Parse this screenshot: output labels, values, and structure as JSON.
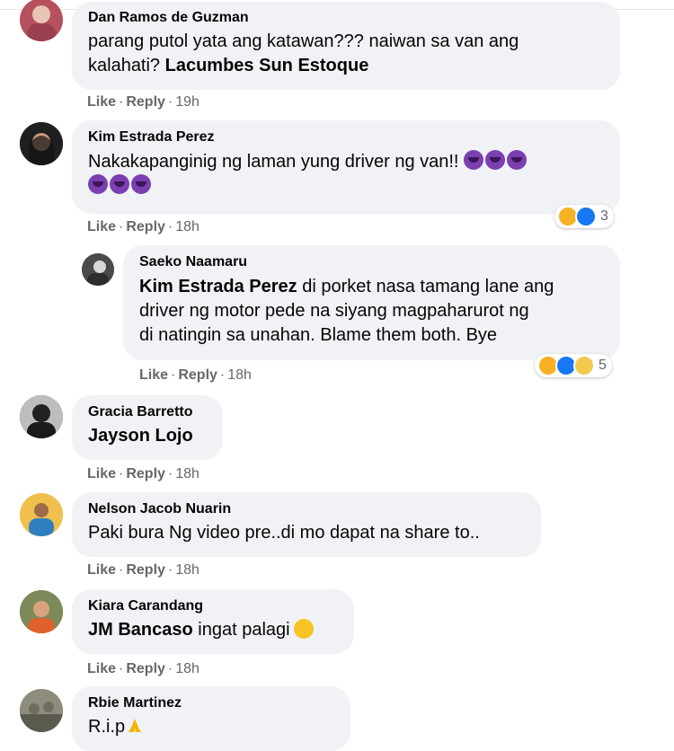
{
  "comments": [
    {
      "name": "Dan Ramos de Guzman",
      "text_line1": "parang putol yata ang katawan??? naiwan sa van ang",
      "text_line2": "kalahati?",
      "tag": "Lacumbes Sun Estoque",
      "like": "Like",
      "reply": "Reply",
      "time": "19h",
      "avatar_color": "#b5505e"
    },
    {
      "name": "Kim Estrada Perez",
      "text_line1": "Nakakapanginig ng laman yung driver ng van!!",
      "like": "Like",
      "reply": "Reply",
      "time": "18h",
      "reaction_count": "3",
      "avatar_color": "#2a2a2a"
    },
    {
      "name": "Saeko Naamaru",
      "tag": "Kim Estrada Perez",
      "text_line1": "di porket nasa tamang lane ang",
      "text_line2": "driver ng motor pede na siyang magpaharurot ng",
      "text_line3": "di natingin sa unahan. Blame them both. Bye",
      "like": "Like",
      "reply": "Reply",
      "time": "18h",
      "reaction_count": "5",
      "avatar_color": "#5a5a5a"
    },
    {
      "name": "Gracia Barretto",
      "tag": "Jayson Lojo",
      "like": "Like",
      "reply": "Reply",
      "time": "18h",
      "avatar_color": "#3b3b3b"
    },
    {
      "name": "Nelson Jacob Nuarin",
      "text_line1": "Paki bura Ng video pre..di mo dapat na share to..",
      "like": "Like",
      "reply": "Reply",
      "time": "18h",
      "avatar_color": "#e8b13c"
    },
    {
      "name": "Kiara Carandang",
      "tag": "JM Bancaso",
      "text_line1": "ingat palagi",
      "like": "Like",
      "reply": "Reply",
      "time": "18h",
      "avatar_color": "#8a7a52"
    },
    {
      "name": "Rbie Martinez",
      "text_line1": "R.i.p",
      "avatar_color": "#6d6b5f"
    }
  ],
  "colors": {
    "bubble": "#f0f2f5",
    "meta": "#65676b",
    "reaction_haha": "#f7b125",
    "reaction_like": "#1877f2",
    "reaction_care": "#f2c94c"
  },
  "icons": [
    "devil-emoji",
    "pleading-face-emoji",
    "folded-hands-emoji",
    "haha-reaction-icon",
    "like-reaction-icon",
    "care-reaction-icon"
  ]
}
